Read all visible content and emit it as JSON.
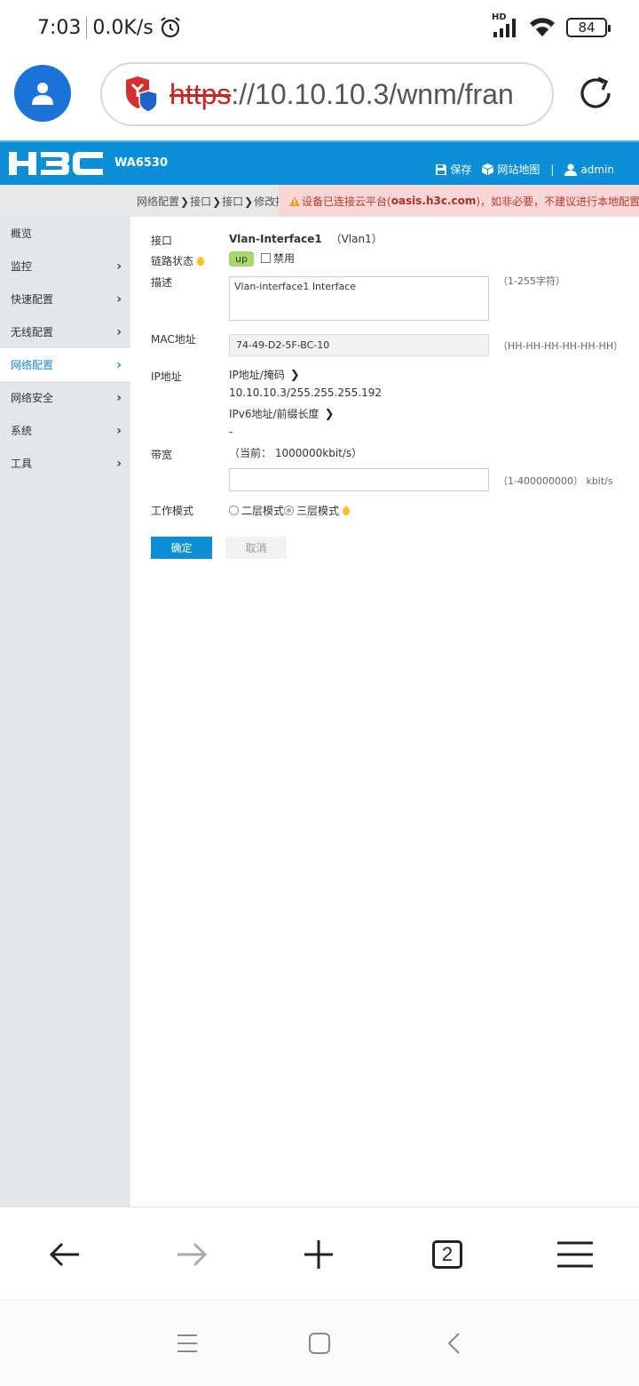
{
  "status_bar": {
    "time": "7:03",
    "net_speed": "0.0K/s",
    "network_badge": "HD",
    "battery": "84",
    "icons": [
      "alarm-icon",
      "signal-icon",
      "wifi-icon",
      "battery-icon"
    ]
  },
  "browser": {
    "url_scheme": "https",
    "url_rest": "://10.10.10.3/wnm/fran",
    "tab_count": "2",
    "icons": [
      "profile-icon",
      "security-shield-icon",
      "reload-icon",
      "back-icon",
      "forward-icon",
      "new-tab-icon",
      "menu-icon"
    ]
  },
  "header": {
    "logo_text": "H3C",
    "model": "WA6530",
    "save_label": "保存",
    "sitemap_label": "网站地图",
    "divider": "|",
    "user": "admin",
    "brand_color": "#0a8fd7"
  },
  "breadcrumb": {
    "items": [
      "网络配置",
      "接口",
      "接口",
      "修改接"
    ],
    "separator": "❯"
  },
  "warning": {
    "prefix": "设备已连接云平台(",
    "domain": "oasis.h3c.com",
    "suffix": ")，如非必要，不建议进行本地配置。"
  },
  "sidebar": {
    "items": [
      {
        "label": "概览",
        "has_chevron": false,
        "active": false
      },
      {
        "label": "监控",
        "has_chevron": true,
        "active": false
      },
      {
        "label": "快速配置",
        "has_chevron": true,
        "active": false
      },
      {
        "label": "无线配置",
        "has_chevron": true,
        "active": false
      },
      {
        "label": "网络配置",
        "has_chevron": true,
        "active": true
      },
      {
        "label": "网络安全",
        "has_chevron": true,
        "active": false
      },
      {
        "label": "系统",
        "has_chevron": true,
        "active": false
      },
      {
        "label": "工具",
        "has_chevron": true,
        "active": false
      }
    ],
    "chevron": "›"
  },
  "form": {
    "interface_label": "接口",
    "interface_name": "Vlan-Interface1",
    "interface_alias": "（Vlan1）",
    "link_status_label": "链路状态",
    "link_status_value": "up",
    "disable_label": "禁用",
    "description_label": "描述",
    "description_value": "Vlan-interface1 Interface",
    "description_hint": "（1-255字符）",
    "mac_label": "MAC地址",
    "mac_value": "74-49-D2-5F-BC-10",
    "mac_hint": "（HH-HH-HH-HH-HH-HH）",
    "ip_label": "IP地址",
    "ipv4_link": "IP地址/掩码",
    "ipv4_value": "10.10.10.3/255.255.255.192",
    "ipv6_link": "IPv6地址/前缀长度",
    "ipv6_value": "-",
    "bandwidth_label": "带宽",
    "bandwidth_current": "（当前： 1000000kbit/s）",
    "bandwidth_value": "",
    "bandwidth_hint": "（1-400000000） kbit/s",
    "mode_label": "工作模式",
    "mode_l2": "二层模式",
    "mode_l3": "三层模式",
    "ok_label": "确定",
    "cancel_label": "取消"
  }
}
